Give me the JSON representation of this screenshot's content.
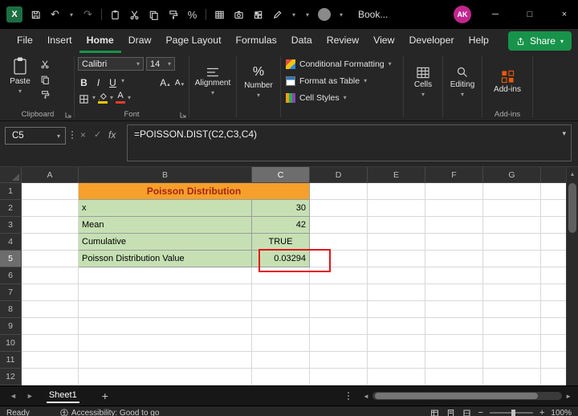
{
  "window": {
    "logo_letter": "X",
    "title": "Book...",
    "avatar_initials": "AK"
  },
  "icons": {
    "dropdown": "▾",
    "undo": "↶",
    "redo": "↷",
    "percent": "%",
    "cancel": "×",
    "check": "✓",
    "fx": "fx",
    "minimize": "─",
    "maximize": "□",
    "close": "×",
    "nav_left": "◄",
    "nav_right": "►",
    "scroll_up": "▴",
    "add": "+",
    "zoom_out": "−",
    "zoom_in": "+"
  },
  "menu": {
    "tabs": [
      {
        "label": "File"
      },
      {
        "label": "Insert"
      },
      {
        "label": "Home",
        "active": true
      },
      {
        "label": "Draw"
      },
      {
        "label": "Page Layout"
      },
      {
        "label": "Formulas"
      },
      {
        "label": "Data"
      },
      {
        "label": "Review"
      },
      {
        "label": "View"
      },
      {
        "label": "Developer"
      },
      {
        "label": "Help"
      }
    ],
    "share_label": "Share"
  },
  "ribbon": {
    "paste": "Paste",
    "font_name": "Calibri",
    "font_size": "14",
    "bold": "B",
    "italic": "I",
    "underline": "U",
    "grow_font": "A",
    "shrink_font": "A",
    "font_color": "A",
    "alignment": "Alignment",
    "number": "Number",
    "styles": [
      "Conditional Formatting",
      "Format as Table",
      "Cell Styles"
    ],
    "cells": "Cells",
    "editing": "Editing",
    "addins": "Add-ins",
    "labels": {
      "clipboard": "Clipboard",
      "font": "Font",
      "addins": "Add-ins"
    }
  },
  "formula_bar": {
    "name_box": "C5",
    "formula": "=POISSON.DIST(C2,C3,C4)"
  },
  "sheet": {
    "columns": [
      "A",
      "B",
      "C",
      "D",
      "E",
      "F",
      "G"
    ],
    "row_count": 12,
    "selected_column": "C",
    "selected_row": 5
  },
  "worksheet": {
    "title": "Poisson Distribution",
    "entries": [
      {
        "row": 2,
        "label": "x",
        "value": "30",
        "align": "right"
      },
      {
        "row": 3,
        "label": "Mean",
        "value": "42",
        "align": "right"
      },
      {
        "row": 4,
        "label": "Cumulative",
        "value": "TRUE",
        "align": "center"
      },
      {
        "row": 5,
        "label": "Poisson Distribution Value",
        "value": "0.03294",
        "align": "right",
        "annotated": true
      }
    ]
  },
  "tabs_bar": {
    "sheet_name": "Sheet1"
  },
  "status_bar": {
    "ready": "Ready",
    "accessibility": "Accessibility: Good to go",
    "zoom": "100%"
  },
  "colors": {
    "accent_green": "#17934B",
    "logo_green": "#1D6F42",
    "header_orange": "#F5A02B",
    "header_title_text": "#A92313",
    "cell_green": "#C6E0B4",
    "annotation_red": "#E3131B",
    "avatar_pink": "#C3268F"
  }
}
